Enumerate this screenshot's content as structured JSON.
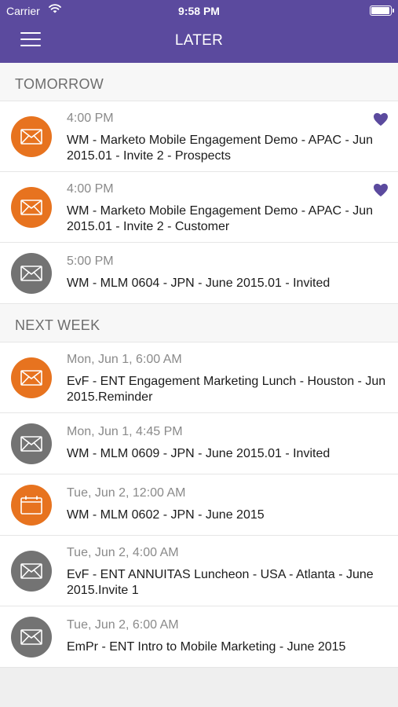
{
  "status_bar": {
    "carrier": "Carrier",
    "time": "9:58 PM",
    "battery_level": 0.95
  },
  "nav": {
    "title": "LATER",
    "menu_icon": "hamburger-menu-icon"
  },
  "colors": {
    "header": "#5b4a9e",
    "email_orange": "#e7731f",
    "email_gray": "#737373",
    "favorite": "#5b4a9e"
  },
  "sections": [
    {
      "title": "TOMORROW",
      "items": [
        {
          "time": "4:00 PM",
          "subject": "WM - Marketo Mobile Engagement Demo - APAC - Jun 2015.01 - Invite 2 - Prospects",
          "icon": "envelope-icon",
          "color": "orange",
          "favorite": true
        },
        {
          "time": "4:00 PM",
          "subject": "WM - Marketo Mobile Engagement Demo - APAC - Jun 2015.01 - Invite 2 - Customer",
          "icon": "envelope-icon",
          "color": "orange",
          "favorite": true
        },
        {
          "time": "5:00 PM",
          "subject": "WM - MLM 0604 - JPN - June 2015.01 - Invited",
          "icon": "envelope-icon",
          "color": "gray",
          "favorite": false
        }
      ]
    },
    {
      "title": "NEXT WEEK",
      "items": [
        {
          "time": "Mon, Jun 1, 6:00 AM",
          "subject": "EvF - ENT Engagement Marketing Lunch - Houston - Jun 2015.Reminder",
          "icon": "envelope-icon",
          "color": "orange",
          "favorite": false
        },
        {
          "time": "Mon, Jun 1, 4:45 PM",
          "subject": "WM - MLM 0609 - JPN - June 2015.01 - Invited",
          "icon": "envelope-icon",
          "color": "gray",
          "favorite": false
        },
        {
          "time": "Tue, Jun 2, 12:00 AM",
          "subject": "WM - MLM 0602 - JPN - June 2015",
          "icon": "calendar-icon",
          "color": "orange",
          "favorite": false
        },
        {
          "time": "Tue, Jun 2, 4:00 AM",
          "subject": "EvF - ENT ANNUITAS Luncheon - USA - Atlanta - June 2015.Invite 1",
          "icon": "envelope-icon",
          "color": "gray",
          "favorite": false
        },
        {
          "time": "Tue, Jun 2, 6:00 AM",
          "subject": "EmPr - ENT Intro to Mobile Marketing - June 2015",
          "icon": "envelope-icon",
          "color": "gray",
          "favorite": false
        }
      ]
    }
  ]
}
